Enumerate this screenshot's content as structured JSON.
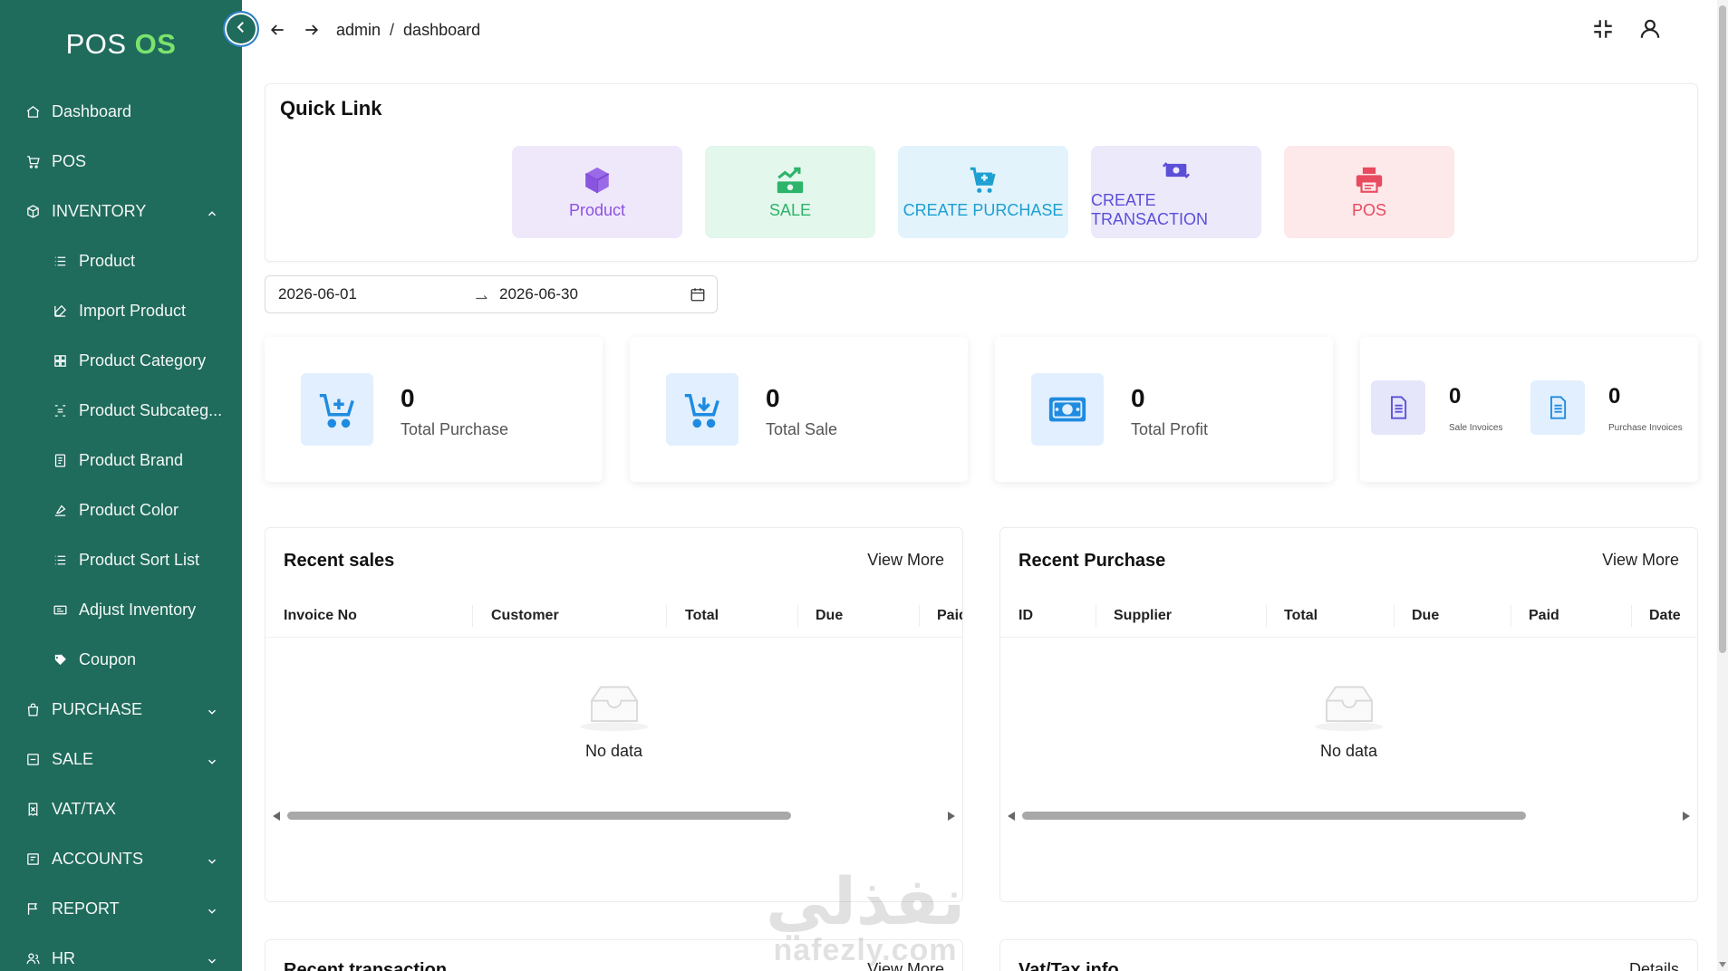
{
  "brand": {
    "name_a": "POS",
    "name_b": "OS"
  },
  "sidebar": {
    "items": [
      {
        "label": "Dashboard",
        "icon": "home-icon"
      },
      {
        "label": "POS",
        "icon": "cart-icon"
      },
      {
        "label": "INVENTORY",
        "icon": "box-icon",
        "expanded": true
      },
      {
        "label": "Product",
        "icon": "list-icon"
      },
      {
        "label": "Import Product",
        "icon": "edit-icon"
      },
      {
        "label": "Product Category",
        "icon": "grid-icon"
      },
      {
        "label": "Product Subcateg...",
        "icon": "subcategory-icon"
      },
      {
        "label": "Product Brand",
        "icon": "brand-icon"
      },
      {
        "label": "Product Color",
        "icon": "paint-icon"
      },
      {
        "label": "Product Sort List",
        "icon": "sort-list-icon"
      },
      {
        "label": "Adjust Inventory",
        "icon": "adjust-icon"
      },
      {
        "label": "Coupon",
        "icon": "coupon-icon"
      },
      {
        "label": "PURCHASE",
        "icon": "bag-icon"
      },
      {
        "label": "SALE",
        "icon": "sale-icon"
      },
      {
        "label": "VAT/TAX",
        "icon": "tax-icon"
      },
      {
        "label": "ACCOUNTS",
        "icon": "accounts-icon"
      },
      {
        "label": "REPORT",
        "icon": "flag-icon"
      },
      {
        "label": "HR",
        "icon": "users-icon"
      }
    ]
  },
  "header": {
    "breadcrumb": [
      "admin",
      "dashboard"
    ],
    "separator": "/"
  },
  "quick_link": {
    "title": "Quick Link",
    "items": [
      {
        "label": "Product",
        "bg": "#efe8fb",
        "color": "#8c52e0"
      },
      {
        "label": "SALE",
        "bg": "#e3f7ec",
        "color": "#2db36a"
      },
      {
        "label": "CREATE PURCHASE",
        "bg": "#e2f3fb",
        "color": "#1d9fd2"
      },
      {
        "label": "CREATE TRANSACTION",
        "bg": "#ece9fb",
        "color": "#5b4fd8"
      },
      {
        "label": "POS",
        "bg": "#fde8ea",
        "color": "#e84a5f"
      }
    ]
  },
  "date_range": {
    "start": "2026-06-01",
    "end": "2026-06-30"
  },
  "stats": [
    {
      "value": "0",
      "label": "Total Purchase"
    },
    {
      "value": "0",
      "label": "Total Sale"
    },
    {
      "value": "0",
      "label": "Total Profit"
    }
  ],
  "invoices": {
    "sale": {
      "value": "0",
      "label": "Sale Invoices"
    },
    "purchase": {
      "value": "0",
      "label": "Purchase Invoices"
    }
  },
  "recent_sales": {
    "title": "Recent sales",
    "more": "View More",
    "columns": [
      "Invoice No",
      "Customer",
      "Total",
      "Due",
      "Paid"
    ],
    "empty": "No data"
  },
  "recent_purchase": {
    "title": "Recent Purchase",
    "more": "View More",
    "columns": [
      "ID",
      "Supplier",
      "Total",
      "Due",
      "Paid",
      "Date"
    ],
    "empty": "No data"
  },
  "recent_transaction": {
    "title": "Recent transaction",
    "more": "View More"
  },
  "vat_info": {
    "title": "Vat/Tax info",
    "more": "Details"
  },
  "watermark": {
    "arabic": "نفذلي",
    "latin": "nafezly.com"
  },
  "colors": {
    "sidebar": "#1f6b5c",
    "accent_green": "#7be36d",
    "stat_icon": "#1e8be0"
  }
}
